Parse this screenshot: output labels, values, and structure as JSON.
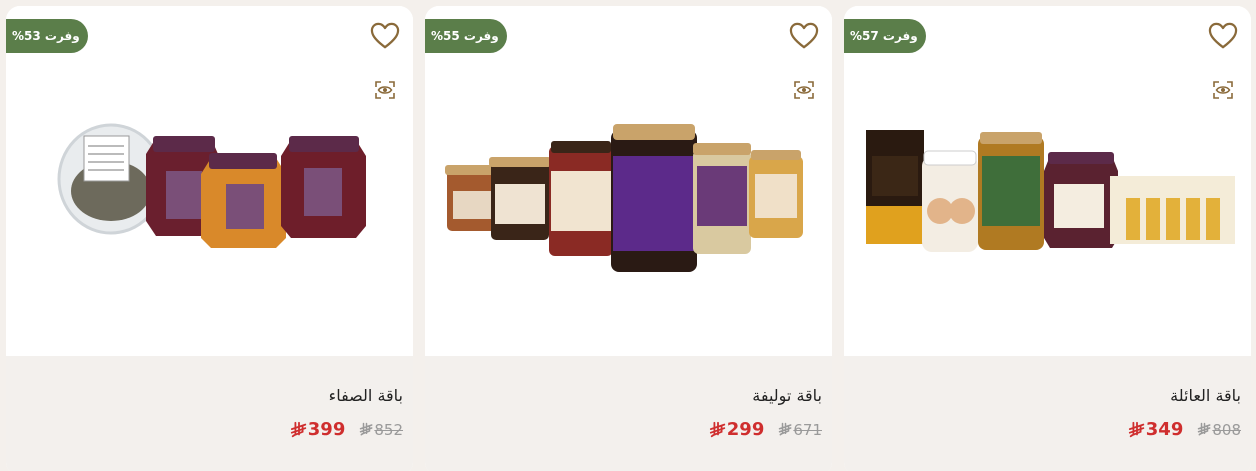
{
  "colors": {
    "badge": "#5b7e4a",
    "sale_price": "#cf2e2e",
    "old_price": "#9a9a9a",
    "heart": "#8a6a3a",
    "card_info_bg": "#f3f0ed"
  },
  "products": [
    {
      "title": "باقة الصفاء",
      "badge": "وفرت 53%",
      "price_old": "852",
      "price_new": "399",
      "currency_icon": "riyal-icon"
    },
    {
      "title": "باقة توليفة",
      "badge": "وفرت 55%",
      "price_old": "671",
      "price_new": "299",
      "currency_icon": "riyal-icon"
    },
    {
      "title": "باقة العائلة",
      "badge": "وفرت 57%",
      "price_old": "808",
      "price_new": "349",
      "currency_icon": "riyal-icon"
    }
  ],
  "icons": {
    "wishlist": "heart-icon",
    "quick_view": "eye-icon"
  }
}
